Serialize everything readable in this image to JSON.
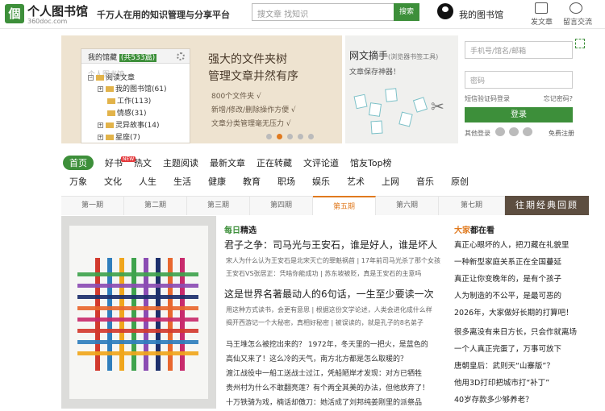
{
  "header": {
    "logo_glyph": "個",
    "brand": "个人图书馆",
    "domain": "360doc.com",
    "slogan": "千万人在用的知识管理与分享平台",
    "search_placeholder": "搜文章  找知识",
    "search_button": "搜索",
    "my_library": "我的图书馆",
    "post_label": "发文章",
    "message_label": "留言交流"
  },
  "banner": {
    "tree_root": "我的馆藏",
    "tree_count": "(共533篇)",
    "tree_items": [
      "个人图书馆",
      "阅读文章",
      "我的图书馆(61)",
      "工作(113)",
      "情感(31)",
      "灵异故事(14)",
      "星座(7)"
    ],
    "title_line1": "强大的文件夹树",
    "title_line2": "管理文章井然有序",
    "bullets": [
      "800个文件夹 √",
      "新增/修改/删除操作方便 √",
      "文章分类管理毫无压力 √"
    ]
  },
  "web_clip": {
    "title": "网文摘手",
    "title_note": "(浏览器书签工具)",
    "subtitle": "文章保存神器！"
  },
  "login": {
    "account_placeholder": "手机号/馆名/邮箱",
    "password_placeholder": "密码",
    "sms_login": "短信验证码登录",
    "forgot": "忘记密码?",
    "login_button": "登录",
    "other_login": "其他登录",
    "register": "免费注册"
  },
  "nav": {
    "row1": [
      "首页",
      "好书",
      "热文",
      "主题阅读",
      "最新文章",
      "正在转藏",
      "文评论道",
      "馆友Top榜"
    ],
    "new_badge": "NEW",
    "row2": [
      "万象",
      "文化",
      "人生",
      "生活",
      "健康",
      "教育",
      "职场",
      "娱乐",
      "艺术",
      "上网",
      "音乐",
      "原创"
    ]
  },
  "tabs": [
    "第一期",
    "第二期",
    "第三期",
    "第四期",
    "第五期",
    "第六期",
    "第七期"
  ],
  "active_tab_index": 4,
  "review_label": "往期经典回顾",
  "daily": {
    "label_prefix": "每日",
    "label_suffix": "精选",
    "headline1": "君子之争：司马光与王安石，谁是好人，谁是坏人",
    "summary1": "宋人为什么认为王安石是北宋灭亡的罪魁祸首 | 17年前司马光杀了那个女孩 王安石VS张居正：凭啥你能成功 | 苏东坡被贬，真是王安石的主意吗",
    "headline2": "这是世界名著最动人的6句话，一生至少要读一次",
    "summary2": "用这种方式读书，会更有意思 | 根据这份文学论述，人类会进化成什么样 揭开西游记一个大秘密，真相好秘密 | 被误读的，就是孔子的8名弟子",
    "news": [
      "马王堆怎么被挖出来的？ 1972年，冬天里的一把火，是蓝色的",
      "高仙又来了！这么冷的天气，南方北方都是怎么取暖的？",
      "渡江战役中一船工送战士过江，凭船陋岸才发现：对方已牺牲",
      "贵州村为什么不敢翻亮莲？有个两全其美的办法，但他放弃了！",
      "十万铁骑为戏，楠话却傲刀：她活成了刘邦纯姜刚里的派祭品"
    ]
  },
  "people": {
    "title_prefix": "大家",
    "title_suffix": "都在看",
    "lines": [
      "真正心眼坏的人，把刀藏在礼貌里",
      "一种新型家庭关系正在全国蔓延",
      "真正让你变晚年的，是有个孩子",
      "人为制造的不公平，是最可恶的",
      "2026年，大家做好长期的打算吧！",
      "",
      "很多离没有来日方长，只会作就离场",
      "一个人真正完蛋了，万事可放下",
      "唐朝皇后：武则天“山寨版”？",
      "他用3D打印把城市打“补丁”",
      "40岁存款多少够养老？"
    ]
  },
  "pencil_colors": [
    "#d23a2e",
    "#2f7ebd",
    "#f0a61c",
    "#3fa34d",
    "#8b4cb3",
    "#1c2f6b",
    "#e8672e",
    "#c82b6d"
  ]
}
